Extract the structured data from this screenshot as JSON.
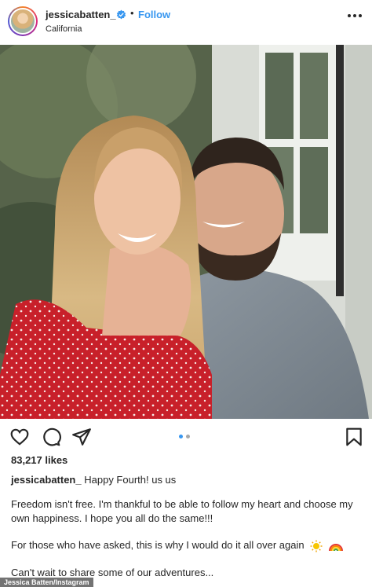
{
  "header": {
    "username": "jessicabatten_",
    "follow_label": "Follow",
    "separator": "•",
    "location": "California"
  },
  "post": {
    "likes": "83,217 likes",
    "carousel": {
      "total": 2,
      "active": 1
    },
    "caption_user": "jessicabatten_",
    "caption_first": "Happy Fourth! us us",
    "paragraph_1": "Freedom isn't free. I'm thankful to be able to follow my heart and choose my own happiness. I hope you all do the same!!!",
    "paragraph_2": "For those who have asked, this is why I would do it all over again",
    "paragraph_3": "Can't wait to share some of our adventures..."
  },
  "credit": "Jessica Batten/Instagram",
  "colors": {
    "accent": "#3897f0",
    "text": "#262626",
    "dress": "#c8202a"
  },
  "icons": [
    "verified-badge-icon",
    "more-options-icon",
    "heart-icon",
    "comment-icon",
    "share-icon",
    "bookmark-icon",
    "sun-emoji-icon",
    "rainbow-emoji-icon"
  ]
}
